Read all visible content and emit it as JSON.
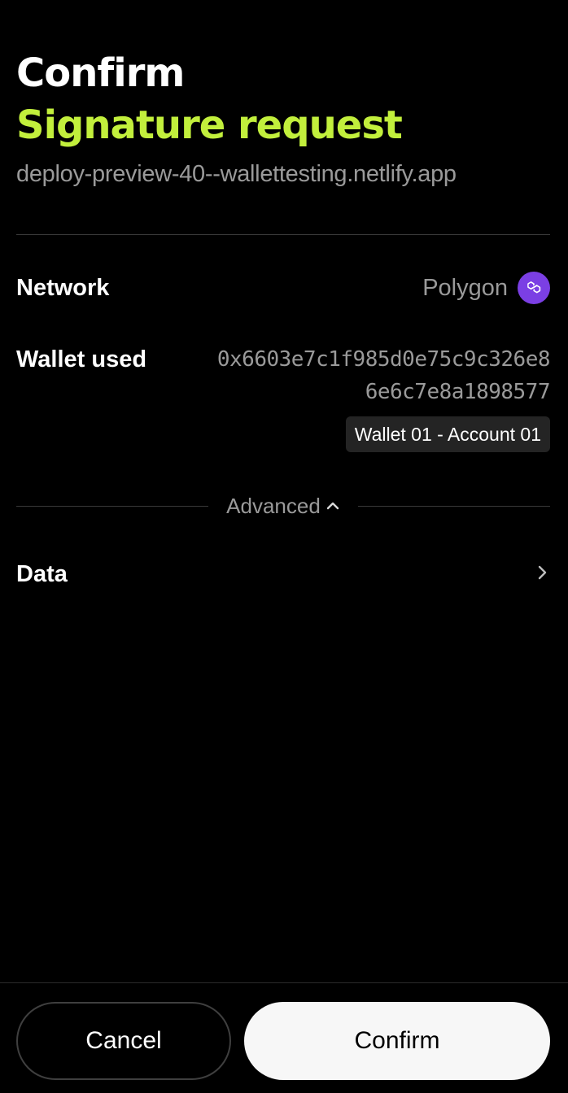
{
  "header": {
    "title": "Confirm",
    "subtitle": "Signature request",
    "origin": "deploy-preview-40--wallettesting.netlify.app"
  },
  "details": {
    "network_label": "Network",
    "network_value": "Polygon",
    "network_icon": "polygon-icon",
    "wallet_label": "Wallet used",
    "wallet_address": "0x6603e7c1f985d0e75c9c326e86e6c7e8a1898577",
    "wallet_account": "Wallet 01 - Account 01"
  },
  "advanced": {
    "label": "Advanced",
    "data_label": "Data"
  },
  "actions": {
    "cancel_label": "Cancel",
    "confirm_label": "Confirm"
  },
  "colors": {
    "accent": "#c2ef3c",
    "polygon": "#7b3fe4",
    "muted_text": "#9a9a9a",
    "background": "#000000"
  }
}
